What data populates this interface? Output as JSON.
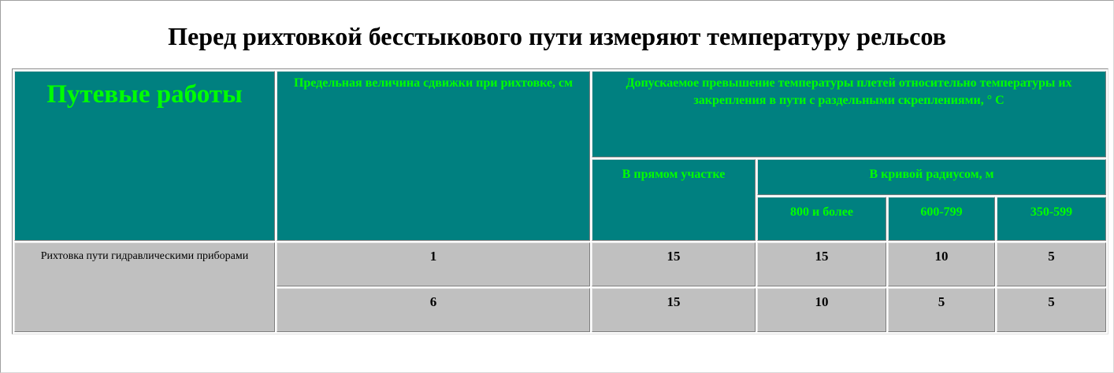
{
  "page": {
    "title": "Перед рихтовкой бесстыкового пути измеряют температуру рельсов"
  },
  "table": {
    "headers": {
      "works": "Путевые работы",
      "shift": "Предельная величина сдвижки при рихтовке, см",
      "temp": "Допускаемое превышение температуры плетей относительно температуры их закрепления в пути с раздельными скреплениями, ° С",
      "straight": "В прямом участке",
      "curve": "В кривой радиусом, м",
      "r800": "800 и более",
      "r600": "600-799",
      "r350": "350-599"
    },
    "work_label": "Рихтовка пути гидравлическими приборами",
    "rows": [
      {
        "shift": "1",
        "straight": "15",
        "r800": "15",
        "r600": "10",
        "r350": "5"
      },
      {
        "shift": "6",
        "straight": "15",
        "r800": "10",
        "r600": "5",
        "r350": "5"
      }
    ]
  }
}
